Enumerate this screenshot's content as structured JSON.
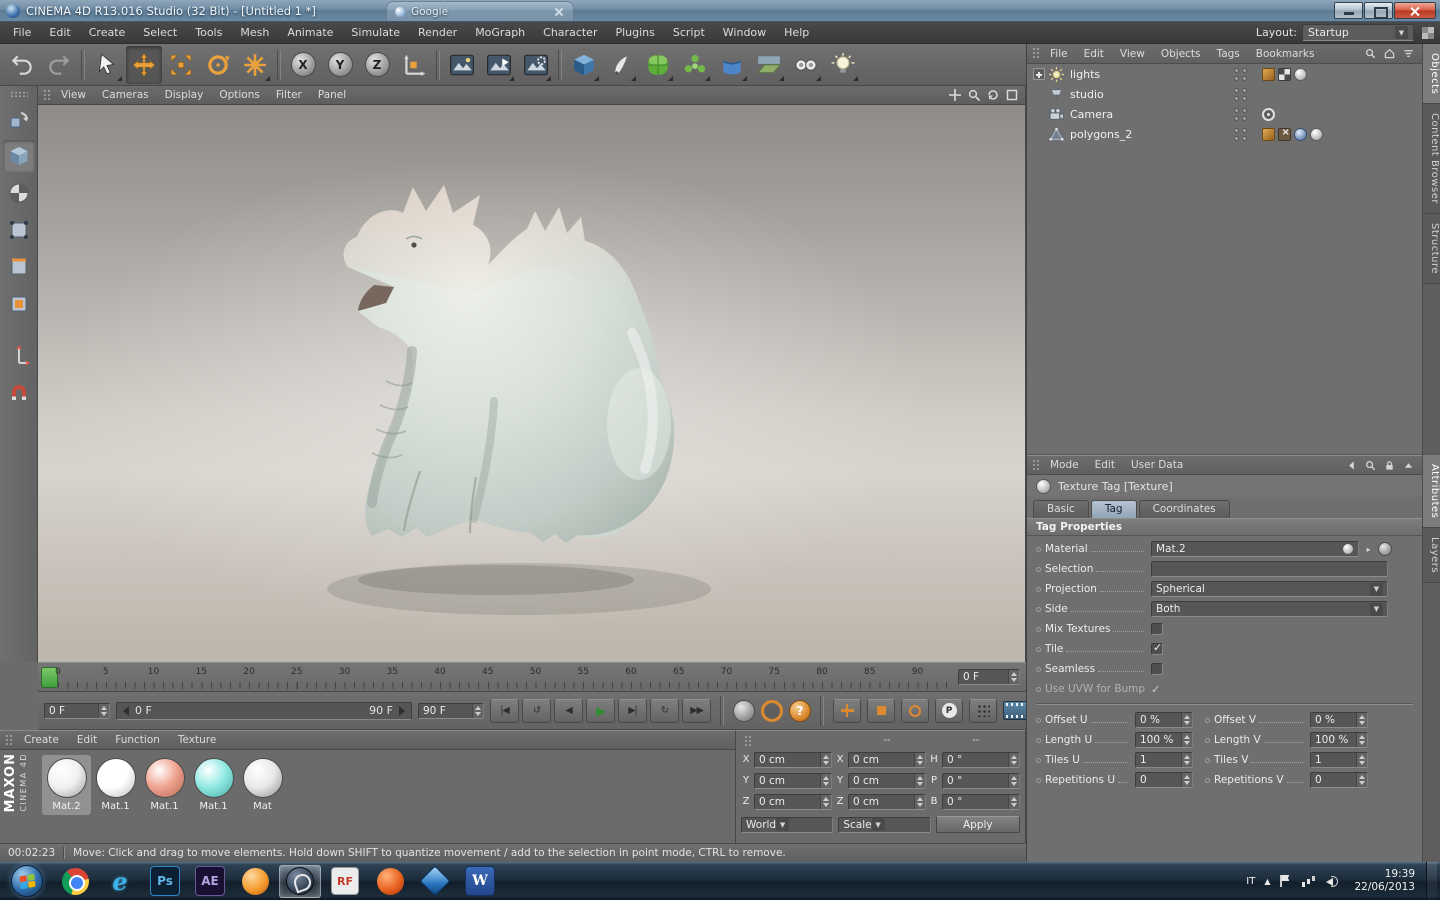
{
  "window": {
    "title": "CINEMA 4D R13.016 Studio (32 Bit) - [Untitled 1 *]",
    "ghost_tab": "Google",
    "menu": [
      "File",
      "Edit",
      "Create",
      "Select",
      "Tools",
      "Mesh",
      "Animate",
      "Simulate",
      "Render",
      "MoGraph",
      "Character",
      "Plugins",
      "Script",
      "Window",
      "Help"
    ],
    "layout_label": "Layout:",
    "layout_value": "Startup"
  },
  "toolbar": {
    "axis_labels": [
      "X",
      "Y",
      "Z"
    ],
    "icons": [
      "undo-icon",
      "redo-icon",
      "live-selection-icon",
      "move-tool-icon",
      "scale-tool-icon",
      "rotate-tool-icon",
      "last-tool-icon",
      "axis-x-button",
      "axis-y-button",
      "axis-z-button",
      "coordinate-system-icon",
      "render-view-icon",
      "render-picture-viewer-icon",
      "render-settings-icon",
      "add-cube-icon",
      "add-spline-icon",
      "add-subdivision-icon",
      "add-array-icon",
      "add-deformer-icon",
      "add-floor-icon",
      "add-camera-icon",
      "add-light-icon"
    ]
  },
  "left_toolbar": {
    "icons": [
      "make-editable-icon",
      "model-mode-icon",
      "texture-mode-icon",
      "point-mode-icon",
      "edge-mode-icon",
      "polygon-mode-icon",
      "axis-mode-icon",
      "snap-icon"
    ]
  },
  "viewport": {
    "menu": [
      "View",
      "Cameras",
      "Display",
      "Options",
      "Filter",
      "Panel"
    ]
  },
  "object_manager": {
    "menu": [
      "File",
      "Edit",
      "View",
      "Objects",
      "Tags",
      "Bookmarks"
    ],
    "objects": [
      {
        "name": "lights",
        "icon": "light",
        "root": true,
        "tags": [
          "compositing-tag",
          "checker-tag",
          "texture-tag"
        ]
      },
      {
        "name": "studio",
        "icon": "stage",
        "root": false,
        "tags": []
      },
      {
        "name": "Camera",
        "icon": "camera",
        "root": false,
        "tags": [
          "target-tag"
        ]
      },
      {
        "name": "polygons_2",
        "icon": "polygon",
        "root": false,
        "tags": [
          "compositing-tag",
          "selection-tag",
          "phong-tag",
          "texture-tag"
        ]
      }
    ]
  },
  "side_tabs": {
    "top": [
      {
        "label": "Objects",
        "active": true
      },
      {
        "label": "Content Browser",
        "active": false
      },
      {
        "label": "Structure",
        "active": false
      }
    ],
    "bottom": [
      {
        "label": "Attributes",
        "active": true
      },
      {
        "label": "Layers",
        "active": false
      }
    ]
  },
  "attribute_manager": {
    "menu": [
      "Mode",
      "Edit",
      "User Data"
    ],
    "title": "Texture Tag [Texture]",
    "tabs": [
      {
        "label": "Basic",
        "active": false
      },
      {
        "label": "Tag",
        "active": true
      },
      {
        "label": "Coordinates",
        "active": false
      }
    ],
    "section": "Tag Properties",
    "rows": [
      {
        "label": "Material",
        "type": "material",
        "value": "Mat.2"
      },
      {
        "label": "Selection",
        "type": "text",
        "value": ""
      },
      {
        "label": "Projection",
        "type": "dropdown",
        "value": "Spherical"
      },
      {
        "label": "Side",
        "type": "dropdown",
        "value": "Both"
      },
      {
        "label": "Mix Textures",
        "type": "checkbox",
        "checked": false
      },
      {
        "label": "Tile",
        "type": "checkbox",
        "checked": true
      },
      {
        "label": "Seamless",
        "type": "checkbox",
        "checked": false
      },
      {
        "label": "Use UVW for Bump",
        "type": "check-disabled",
        "checked": true
      }
    ],
    "uv_rows": [
      {
        "l_label": "Offset U",
        "l_value": "0 %",
        "r_label": "Offset V",
        "r_value": "0 %"
      },
      {
        "l_label": "Length U",
        "l_value": "100 %",
        "r_label": "Length V",
        "r_value": "100 %"
      },
      {
        "l_label": "Tiles U",
        "l_value": "1",
        "r_label": "Tiles V",
        "r_value": "1"
      },
      {
        "l_label": "Repetitions U",
        "l_value": "0",
        "r_label": "Repetitions V",
        "r_value": "0"
      }
    ]
  },
  "timeline": {
    "min": 0,
    "max": 90,
    "step": 5,
    "frame_field": "0 F"
  },
  "transport": {
    "spin_start": "0 F",
    "range_start": "0 F",
    "range_end": "90 F",
    "spin_end": "90 F",
    "buttons": [
      {
        "name": "goto-start-button",
        "glyph": "|◀"
      },
      {
        "name": "play-reverse-button",
        "glyph": "↺"
      },
      {
        "name": "prev-frame-button",
        "glyph": "◀"
      },
      {
        "name": "play-button",
        "glyph": "▶",
        "accent": true
      },
      {
        "name": "next-frame-button",
        "glyph": "▶|"
      },
      {
        "name": "cycle-button",
        "glyph": "↻"
      },
      {
        "name": "goto-end-button",
        "glyph": "▶▶"
      }
    ]
  },
  "keying": {
    "parameter_label": "P",
    "help_label": "?",
    "buttons": [
      "record-button",
      "autokey-button",
      "keyframe-help-button",
      "key-position-button",
      "key-scale-button",
      "key-rotation-button",
      "key-parameter-button",
      "key-pla-button"
    ]
  },
  "materials": {
    "menu": [
      "Create",
      "Edit",
      "Function",
      "Texture"
    ],
    "brand_top": "MAXON",
    "brand_bottom": "CINEMA 4D",
    "items": [
      {
        "name": "Mat.2",
        "color": "#f1f1ef",
        "dark": "#9a9a98",
        "selected": true
      },
      {
        "name": "Mat.1",
        "color": "#ffffff",
        "dark": "#bcbcbc",
        "selected": false
      },
      {
        "name": "Mat.1",
        "color": "#f0a28e",
        "dark": "#b06a55",
        "selected": false
      },
      {
        "name": "Mat.1",
        "color": "#90e9e3",
        "dark": "#48a9a3",
        "selected": false
      },
      {
        "name": "Mat",
        "color": "#e8e8e6",
        "dark": "#909090",
        "selected": false
      }
    ]
  },
  "coordinates": {
    "headers": [
      "",
      "--",
      "--"
    ],
    "rows": [
      {
        "a_label": "X",
        "a": "0 cm",
        "b_label": "X",
        "b": "0 cm",
        "c_label": "H",
        "c": "0 °"
      },
      {
        "a_label": "Y",
        "a": "0 cm",
        "b_label": "Y",
        "b": "0 cm",
        "c_label": "P",
        "c": "0 °"
      },
      {
        "a_label": "Z",
        "a": "0 cm",
        "b_label": "Z",
        "b": "0 cm",
        "c_label": "B",
        "c": "0 °"
      }
    ],
    "space_value": "World",
    "scale_value": "Scale",
    "apply_label": "Apply"
  },
  "status_bar": {
    "time": "00:02:23",
    "message": "Move: Click and drag to move elements. Hold down SHIFT to quantize movement / add to the selection in point mode, CTRL to remove."
  },
  "taskbar": {
    "ps_label": "Ps",
    "ae_label": "AE",
    "ie_label": "e",
    "rf_label": "RF",
    "word_label": "W",
    "tray_lang": "IT",
    "tray_arrow": "▲",
    "time": "19:39",
    "date": "22/06/2013"
  },
  "accent_colors": {
    "tool_orange": "#e39a3b",
    "play_green": "#3fae3f",
    "playhead_green": "#4ca84c",
    "tab_active": "#9db0c2"
  }
}
